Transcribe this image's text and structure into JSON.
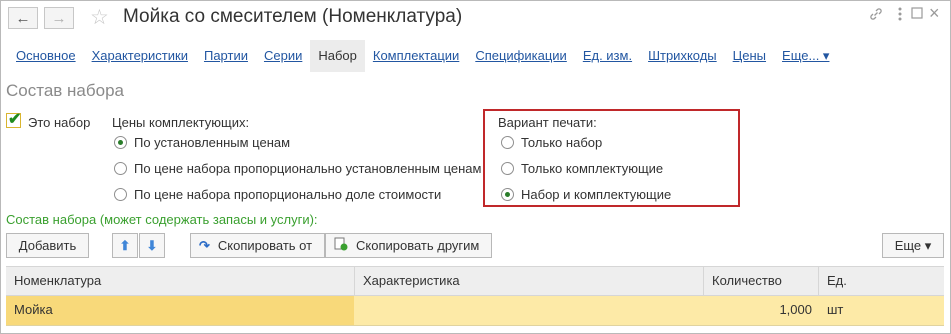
{
  "window": {
    "title": "Мойка со смесителем (Номенклатура)",
    "back_icon": "←",
    "forward_icon": "→",
    "star_icon": "☆",
    "link_icon": "🔗",
    "more_icon": "⋮",
    "maximize_icon": "☐",
    "close_icon": "×"
  },
  "tabs": [
    {
      "label": "Основное"
    },
    {
      "label": "Характеристики"
    },
    {
      "label": "Партии"
    },
    {
      "label": "Серии"
    },
    {
      "label": "Набор"
    },
    {
      "label": "Комплектации"
    },
    {
      "label": "Спецификации"
    },
    {
      "label": "Ед. изм."
    },
    {
      "label": "Штрихкоды"
    },
    {
      "label": "Цены"
    },
    {
      "label": "Еще... ▾"
    }
  ],
  "section_title": "Состав набора",
  "is_set": {
    "label": "Это набор",
    "checked": true
  },
  "component_prices": {
    "label": "Цены комплектующих:",
    "options": [
      {
        "label": "По установленным ценам",
        "selected": true
      },
      {
        "label": "По цене набора пропорционально установленным ценам",
        "selected": false
      },
      {
        "label": "По цене набора пропорционально доле стоимости",
        "selected": false
      }
    ]
  },
  "print_variant": {
    "label": "Вариант печати:",
    "options": [
      {
        "label": "Только набор",
        "selected": false
      },
      {
        "label": "Только комплектующие",
        "selected": false
      },
      {
        "label": "Набор и комплектующие",
        "selected": true
      }
    ]
  },
  "set_contents_label": "Состав набора (может содержать запасы и услуги):",
  "toolbar": {
    "add": "Добавить",
    "up_icon": "⬆",
    "down_icon": "⬇",
    "copy_from": "Скопировать от",
    "copy_to_others": "Скопировать другим",
    "more": "Еще ▾"
  },
  "table": {
    "columns": [
      "Номенклатура",
      "Характеристика",
      "Количество",
      "Ед."
    ],
    "rows": [
      {
        "item": "Мойка",
        "characteristic": "",
        "quantity": "1,000",
        "unit": "шт"
      }
    ]
  },
  "colors": {
    "link": "#2256a1",
    "accent_green": "#3aa02f",
    "highlight_red": "#c0282a",
    "selected_row": "#fdeaa7"
  }
}
